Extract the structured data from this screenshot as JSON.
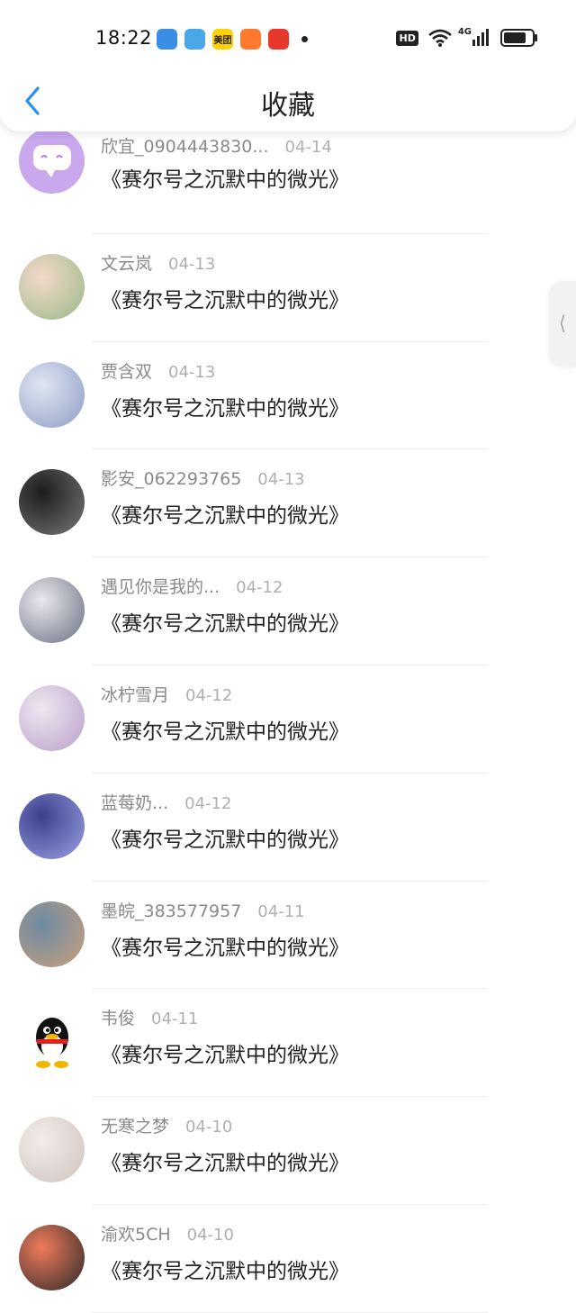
{
  "status_bar": {
    "time": "18:22",
    "apps": [
      {
        "icon": "feather-app-icon",
        "color": "#3a8ee6",
        "label": ""
      },
      {
        "icon": "swirl-app-icon",
        "color": "#4aa8e8",
        "label": ""
      },
      {
        "icon": "meituan-app-icon",
        "color": "#ffd100",
        "label": "美团"
      },
      {
        "icon": "orange-app-icon",
        "color": "#ff7a2e",
        "label": ""
      },
      {
        "icon": "red-app-icon",
        "color": "#e8382c",
        "label": ""
      }
    ],
    "hd": "HD",
    "network": "4G"
  },
  "header": {
    "title": "收藏",
    "back_icon": "chevron-left-icon",
    "accent": "#2a8ff0"
  },
  "items": [
    {
      "user": "欣宜_0904443830...",
      "date": "04-14",
      "work": "《赛尔号之沉默中的微光》",
      "avatar_colors": [
        "#c9a8ee",
        "#b18be6"
      ]
    },
    {
      "user": "文云岚",
      "date": "04-13",
      "work": "《赛尔号之沉默中的微光》",
      "avatar_colors": [
        "#f2d9c8",
        "#9ab98a"
      ]
    },
    {
      "user": "贾含双",
      "date": "04-13",
      "work": "《赛尔号之沉默中的微光》",
      "avatar_colors": [
        "#dfe6f2",
        "#8e9cc4"
      ]
    },
    {
      "user": "影安_062293765",
      "date": "04-13",
      "work": "《赛尔号之沉默中的微光》",
      "avatar_colors": [
        "#1c1c1c",
        "#777777"
      ]
    },
    {
      "user": "遇见你是我的...",
      "date": "04-12",
      "work": "《赛尔号之沉默中的微光》",
      "avatar_colors": [
        "#e8e8ee",
        "#6b6f80"
      ]
    },
    {
      "user": "冰柠雪月",
      "date": "04-12",
      "work": "《赛尔号之沉默中的微光》",
      "avatar_colors": [
        "#efe6f0",
        "#b8a0c8"
      ]
    },
    {
      "user": "蓝莓奶...",
      "date": "04-12",
      "work": "《赛尔号之沉默中的微光》",
      "avatar_colors": [
        "#3a3f8f",
        "#9aa2e0"
      ]
    },
    {
      "user": "墨皖_383577957",
      "date": "04-11",
      "work": "《赛尔号之沉默中的微光》",
      "avatar_colors": [
        "#6d8aa0",
        "#c8a080"
      ]
    },
    {
      "user": "韦俊",
      "date": "04-11",
      "work": "《赛尔号之沉默中的微光》",
      "avatar_colors": [
        "#ffffff",
        "#ffffff"
      ],
      "qq": true
    },
    {
      "user": "无寒之梦",
      "date": "04-10",
      "work": "《赛尔号之沉默中的微光》",
      "avatar_colors": [
        "#f1ecea",
        "#cfc3be"
      ]
    },
    {
      "user": "渝欢5CH",
      "date": "04-10",
      "work": "《赛尔号之沉默中的微光》",
      "avatar_colors": [
        "#f07a5a",
        "#2a2a2a"
      ]
    }
  ],
  "side_handle": {
    "icon": "chevron-left-icon"
  }
}
